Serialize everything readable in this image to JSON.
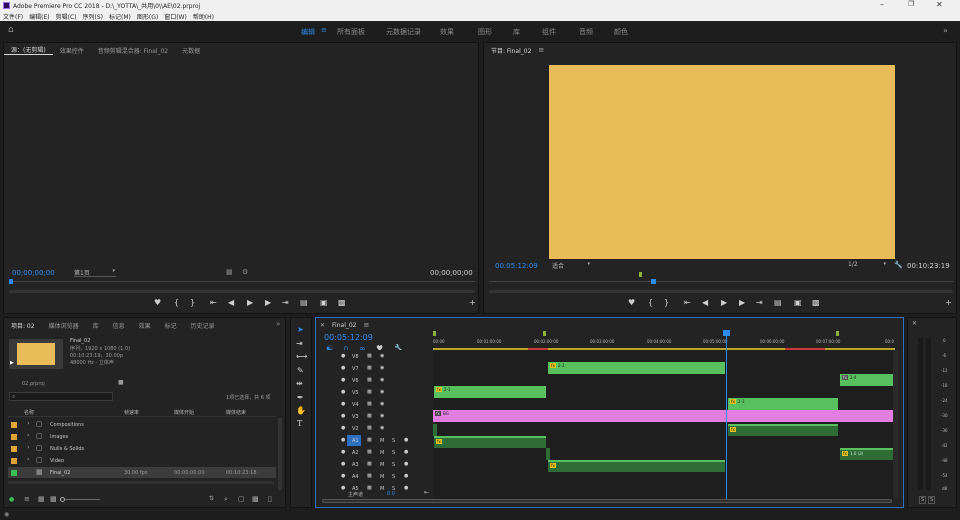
{
  "app": {
    "title": "Adobe Premiere Pro CC 2018 - D:\\_YOTTA\\_共用\\0\\\\AE\\02.prproj",
    "menu": [
      "文件(F)",
      "编辑(E)",
      "剪辑(C)",
      "序列(S)",
      "标记(M)",
      "图形(G)",
      "窗口(W)",
      "帮助(H)"
    ],
    "workspaces": [
      "编辑",
      "所有面板",
      "元数据记录",
      "效果",
      "图形",
      "库",
      "组件",
      "音频",
      "颜色"
    ],
    "active_workspace": "编辑"
  },
  "source": {
    "tabs": [
      "源：(无剪辑)",
      "效果控件",
      "音频剪辑混合器: Final_02",
      "元数据"
    ],
    "timecode_left": "00;00;00;00",
    "page": "第1页",
    "timecode_right": "00;00;00;00"
  },
  "program": {
    "tab": "节目: Final_02",
    "timecode": "00:05:12:09",
    "fit": "适合",
    "resolution": "1/2",
    "duration": "00:10:23:19",
    "frame_color": "#e8bc58"
  },
  "project": {
    "tabs": [
      "项目: 02",
      "媒体浏览器",
      "库",
      "信息",
      "效果",
      "标记",
      "历史记录"
    ],
    "clip_name": "Final_02",
    "clip_type": "序列，1920 x 1080 (1.0)",
    "clip_duration": "00:10:23:19，30.00p",
    "clip_audio": "48000 Hz - 立体声",
    "file": "02.prproj",
    "selection_info": "1项已选择，共 6 项",
    "columns": [
      "名称",
      "帧速率",
      "媒体开始",
      "媒体结束"
    ],
    "items": [
      {
        "name": "Compositions",
        "fps": "",
        "start": "",
        "end": "",
        "color": "#e0a33a"
      },
      {
        "name": "Images",
        "fps": "",
        "start": "",
        "end": "",
        "color": "#e0a33a"
      },
      {
        "name": "Nulls & Solids",
        "fps": "",
        "start": "",
        "end": "",
        "color": "#e0a33a"
      },
      {
        "name": "Video",
        "fps": "",
        "start": "",
        "end": "",
        "color": "#e0a33a"
      },
      {
        "name": "Final_02",
        "fps": "30.00 fps",
        "start": "00:00:00:00",
        "end": "00:10:23:18",
        "color": "#3bbf54"
      }
    ]
  },
  "timeline": {
    "tab": "Final_02",
    "timecode": "00:05:12:09",
    "ruler": [
      "00:00",
      "00:01:00:00",
      "00:02:00:00",
      "00:03:00:00",
      "00:04:00:00",
      "00:05:00:00",
      "00:06:00:00",
      "00:07:00:00",
      "00:0"
    ],
    "video_tracks": [
      "V8",
      "V7",
      "V6",
      "V5",
      "V4",
      "V3",
      "V2",
      "V1"
    ],
    "audio_tracks": [
      "A1",
      "A2",
      "A3",
      "A4",
      "A5",
      "A6"
    ],
    "master_label": "主声道",
    "master_value": "0.0",
    "clip_labels": {
      "v6_a": "2-2",
      "v4_a": "2-1",
      "v5_a": "2-4",
      "v3_a": "2-3",
      "v2_a": "BG",
      "a6_b": "1.0 (2)"
    }
  },
  "meter": {
    "scale": [
      "0",
      "-6",
      "-12",
      "-18",
      "-24",
      "-30",
      "-36",
      "-42",
      "-48",
      "-54",
      "dB"
    ],
    "sides": [
      "S",
      "S"
    ]
  }
}
